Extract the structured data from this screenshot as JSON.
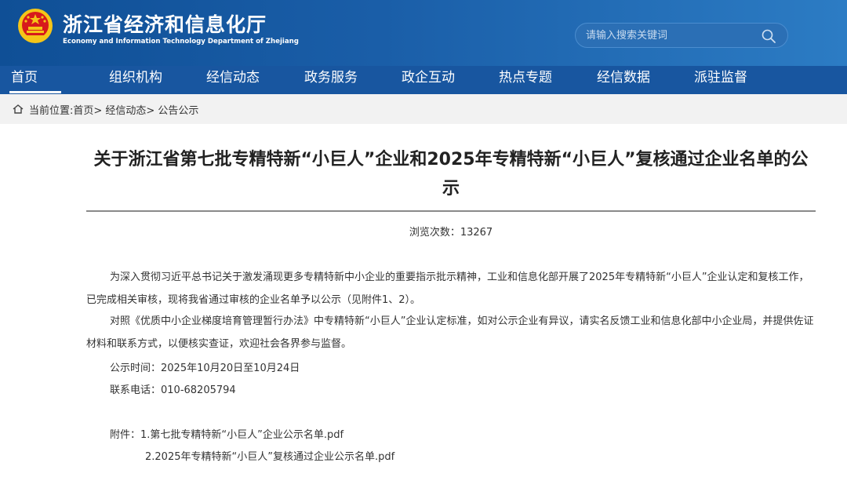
{
  "header": {
    "title_cn": "浙江省经济和信息化厅",
    "title_en": "Economy and Information Technology Department of Zhejiang",
    "search_placeholder": "请输入搜索关键词"
  },
  "nav": {
    "items": [
      {
        "label": "首页",
        "active": true
      },
      {
        "label": "组织机构"
      },
      {
        "label": "经信动态"
      },
      {
        "label": "政务服务"
      },
      {
        "label": "政企互动"
      },
      {
        "label": "热点专题"
      },
      {
        "label": "经信数据"
      },
      {
        "label": "派驻监督"
      }
    ]
  },
  "breadcrumb": {
    "text": "当前位置:首页> 经信动态> 公告公示"
  },
  "article": {
    "title": "关于浙江省第七批专精特新“小巨人”企业和2025年专精特新“小巨人”复核通过企业名单的公示",
    "views": "浏览次数：13267",
    "paragraph1": "为深入贯彻习近平总书记关于激发涌现更多专精特新中小企业的重要指示批示精神，工业和信息化部开展了2025年专精特新“小巨人”企业认定和复核工作，已完成相关审核，现将我省通过审核的企业名单予以公示（见附件1、2）。",
    "paragraph2": "对照《优质中小企业梯度培育管理暂行办法》中专精特新“小巨人”企业认定标准，如对公示企业有异议，请实名反馈工业和信息化部中小企业局，并提供佐证材料和联系方式，以便核实查证，欢迎社会各界参与监督。",
    "period": "公示时间：2025年10月20日至10月24日",
    "phone": "联系电话：010-68205794",
    "attachment1": "附件：1.第七批专精特新“小巨人”企业公示名单.pdf",
    "attachment2": "2.2025年专精特新“小巨人”复核通过企业公示名单.pdf"
  },
  "colors": {
    "header_blue": "#1a5ea8",
    "nav_blue": "#1856a0",
    "emblem_red": "#d7191c",
    "emblem_gold": "#f5c518"
  }
}
